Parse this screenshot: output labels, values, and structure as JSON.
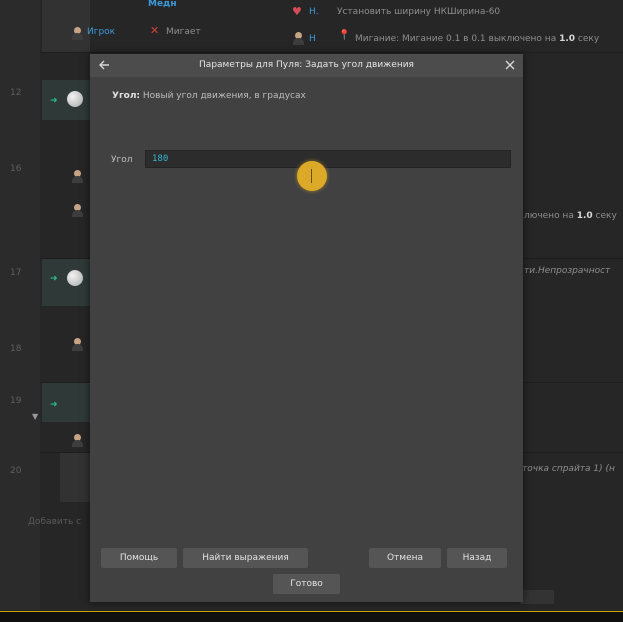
{
  "background": {
    "line_numbers": [
      "12",
      "16",
      "17",
      "18",
      "19",
      "20"
    ],
    "rows": [
      {
        "action_link": "Игрок",
        "action_text": "Мигает"
      },
      {
        "header_partial": "Медн"
      },
      {
        "right_text_prefix": "Н. ",
        "right_text": "Установить ширину НКШирина-60"
      },
      {
        "right_text_prefix": "Н ",
        "right_text_pre": "Мигание: Мигание 0.1 в 0.1 выключено на ",
        "right_text_bold": "1.0",
        "right_text_post": " секу"
      },
      {
        "right_text_pre": "лючено на ",
        "right_text_bold": "1.0",
        "right_text_post": " секу"
      },
      {
        "right_text": "ти.Непрозрачност"
      },
      {
        "right_text": "точка спрайта 1) (н"
      }
    ],
    "add_event_hint": "Добавить с"
  },
  "dialog": {
    "title": "Параметры для Пуля: Задать угол движения",
    "description_label": "Угол:",
    "description_text": "Новый угол движения, в градусах",
    "param_label": "Угол",
    "param_value": "180",
    "buttons": {
      "help": "Помощь",
      "find_expression": "Найти выражения",
      "cancel": "Отмена",
      "back": "Назад",
      "done": "Готово"
    }
  },
  "colors": {
    "accent_link": "#3a9ad9",
    "input_text": "#35b7d1",
    "cursor_highlight": "#e6af28"
  }
}
